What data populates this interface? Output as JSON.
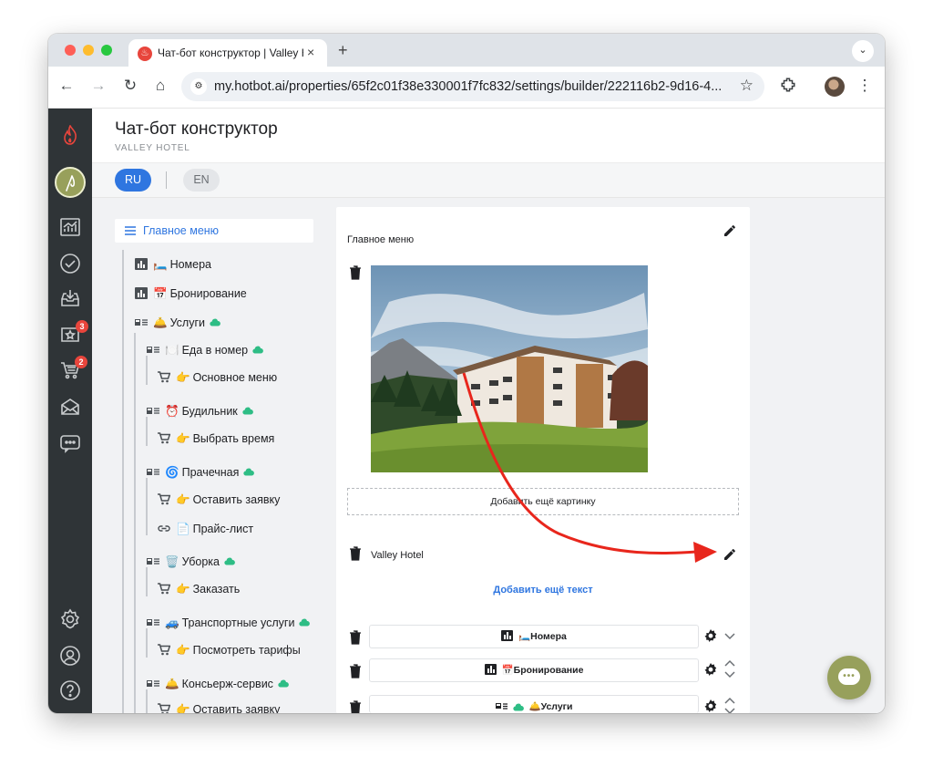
{
  "browser": {
    "tab_title": "Чат-бот конструктор | Valley Hotel",
    "tab_close": "×",
    "new_tab": "+",
    "tab_menu": "⌄",
    "url": "my.hotbot.ai/properties/65f2c01f38e330001f7fc832/settings/builder/222116b2-9d16-4...",
    "back": "←",
    "forward": "→",
    "reload": "↻",
    "home": "⌂",
    "star": "☆",
    "menu": "⋮"
  },
  "sidebar": {
    "badges": {
      "reviews": "3",
      "orders": "2"
    }
  },
  "page": {
    "title": "Чат-бот конструктор",
    "subtitle": "VALLEY HOTEL",
    "languages": {
      "ru": "RU",
      "en": "EN"
    }
  },
  "tree": {
    "root": "Главное меню",
    "items": [
      {
        "emoji": "🛏️",
        "label": "Номера"
      },
      {
        "emoji": "📅",
        "label": "Бронирование"
      },
      {
        "emoji": "🛎️",
        "label": "Услуги"
      },
      {
        "emoji": "🍽️",
        "label": "Еда в номер"
      },
      {
        "emoji": "👉",
        "label": "Основное меню"
      },
      {
        "emoji": "⏰",
        "label": "Будильник"
      },
      {
        "emoji": "👉",
        "label": "Выбрать время"
      },
      {
        "emoji": "🌀",
        "label": "Прачечная"
      },
      {
        "emoji": "👉",
        "label": "Оставить заявку"
      },
      {
        "emoji": "📄",
        "label": "Прайс-лист"
      },
      {
        "emoji": "🗑️",
        "label": "Уборка"
      },
      {
        "emoji": "👉",
        "label": "Заказать"
      },
      {
        "emoji": "🚙",
        "label": "Транспортные услуги"
      },
      {
        "emoji": "👉",
        "label": "Посмотреть тарифы"
      },
      {
        "emoji": "🛎️",
        "label": "Консьерж-сервис"
      },
      {
        "emoji": "👉",
        "label": "Оставить заявку"
      }
    ]
  },
  "editor": {
    "title": "Главное меню",
    "add_image": "Добавить ещё картинку",
    "text_block": "Valley Hotel",
    "add_text": "Добавить ещё текст",
    "buttons": [
      {
        "emoji": "🛏️",
        "label": "Номера"
      },
      {
        "emoji": "📅",
        "label": "Бронирование"
      },
      {
        "emoji": "🛎️",
        "label": "Услуги"
      }
    ]
  },
  "colors": {
    "accent_blue": "#2f76e0",
    "sidebar_bg": "#2f3437",
    "brand_olive": "#97a05c",
    "arrow_red": "#e8261c"
  }
}
